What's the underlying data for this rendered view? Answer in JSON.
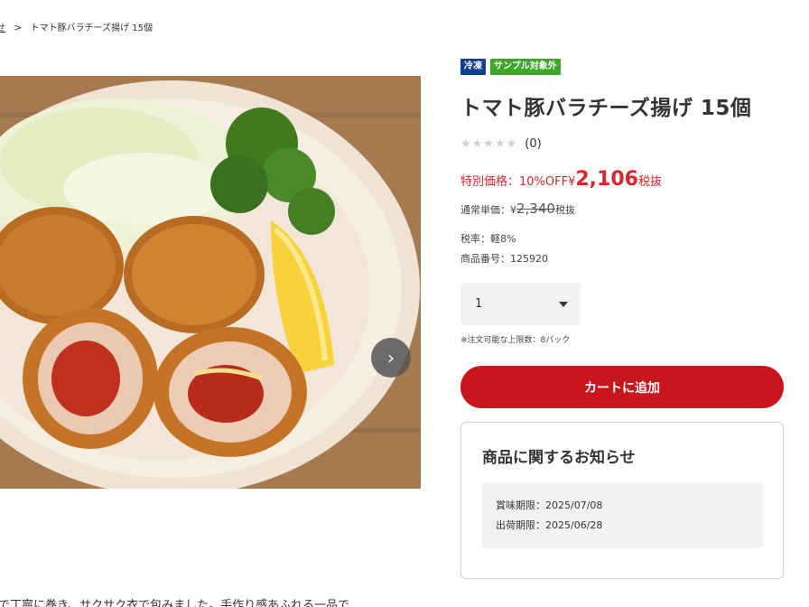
{
  "breadcrumb": {
    "prev_label": "せ",
    "separator": ">",
    "current": "トマト豚バラチーズ揚げ 15個"
  },
  "product": {
    "badges": [
      {
        "label": "冷凍",
        "color": "#0d3f8f"
      },
      {
        "label": "サンプル対象外",
        "color": "#3fa52b"
      }
    ],
    "title": "トマト豚バラチーズ揚げ 15個",
    "rating": {
      "stars": "★★★★★",
      "count_label": "(0)",
      "value": 0,
      "max": 5
    },
    "special_price": {
      "label": "特別価格：10%OFF¥",
      "amount": "2,106",
      "tax_label": "税抜",
      "color": "#d7262e"
    },
    "regular_price": {
      "label": "通常単価：¥",
      "amount": "2,340",
      "tax_label": "税抜"
    },
    "tax_rate": "税率：軽8%",
    "item_number": "商品番号：125920",
    "quantity": {
      "selected": "1"
    },
    "quantity_note": "※注文可能な上限数：8パック",
    "add_to_cart_label": "カートに追加",
    "accent_color": "#c9151e"
  },
  "notice": {
    "title": "商品に関するお知らせ",
    "lines": [
      "賞味期限：2025/07/08",
      "出荷期限：2025/06/28"
    ]
  },
  "description_partial": "で丁寧に巻き、サクサク衣で包みました。手作り感あふれる一品で",
  "icons": {
    "next_arrow": "›",
    "dropdown": "caret-down-icon"
  }
}
